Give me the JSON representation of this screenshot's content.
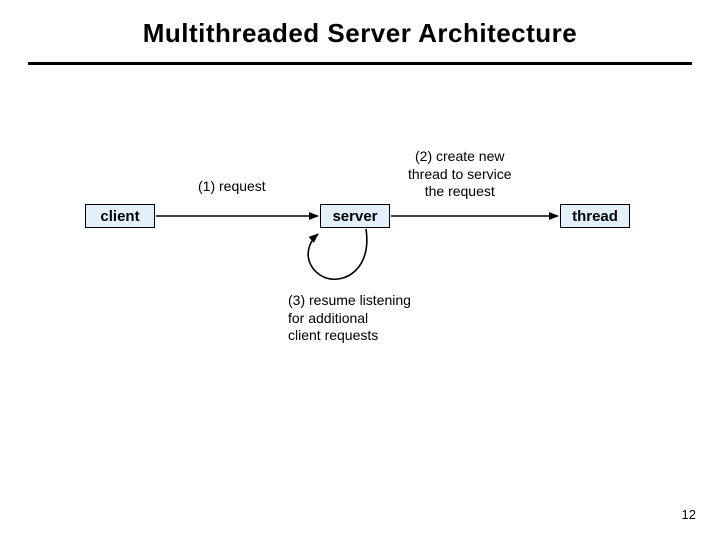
{
  "slide": {
    "title": "Multithreaded Server Architecture",
    "page_number": "12"
  },
  "nodes": {
    "client": "client",
    "server": "server",
    "thread": "thread"
  },
  "labels": {
    "step1": "(1) request",
    "step2": "(2) create new\nthread to service\nthe request",
    "step3": "(3) resume listening\nfor additional\nclient requests"
  }
}
